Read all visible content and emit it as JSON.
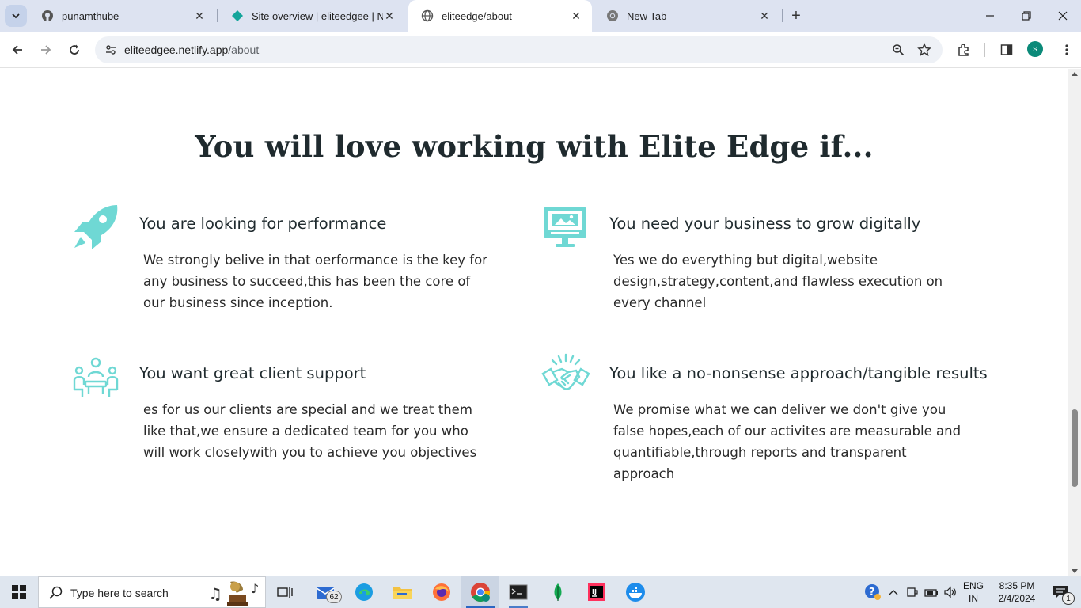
{
  "browser": {
    "tabs": [
      {
        "title": "punamthube",
        "favicon": "github-icon",
        "active": false
      },
      {
        "title": "Site overview | eliteedgee | Netl",
        "favicon": "netlify-icon",
        "active": false
      },
      {
        "title": "eliteedge/about",
        "favicon": "globe-icon",
        "active": true
      },
      {
        "title": "New Tab",
        "favicon": "chrome-icon",
        "active": false
      }
    ],
    "address": {
      "host": "eliteedgee.netlify.app",
      "path": "/about"
    },
    "profile_initial": "s",
    "colors": {
      "tabstrip": "#dde3f1",
      "accent": "#0b8a79"
    }
  },
  "page": {
    "heading": "You will love working with Elite Edge if...",
    "icon_color": "#6fd8d4",
    "features": [
      {
        "icon": "rocket-icon",
        "title": "You are looking for performance",
        "body": "We strongly belive in that oerformance is the key for any business to succeed,this has been the core of our business since inception."
      },
      {
        "icon": "monitor-icon",
        "title": "You need your business to grow digitally",
        "body": "Yes we do everything but digital,website design,strategy,content,and flawless execution on every channel"
      },
      {
        "icon": "team-meeting-icon",
        "title": "You want great client support",
        "body": "es for us our clients are special and we treat them like that,we ensure a dedicated team for you who will work closelywith you to achieve you objectives"
      },
      {
        "icon": "handshake-icon",
        "title": "You like a no-nonsense approach/tangible results",
        "body": "We promise what we can deliver we don't give you false hopes,each of our activites are measurable and quantifiable,through reports and transparent approach"
      }
    ]
  },
  "taskbar": {
    "search_placeholder": "Type here to search",
    "mail_badge": "62",
    "language_line1": "ENG",
    "language_line2": "IN",
    "time": "8:35 PM",
    "date": "2/4/2024",
    "notification_count": "1"
  }
}
